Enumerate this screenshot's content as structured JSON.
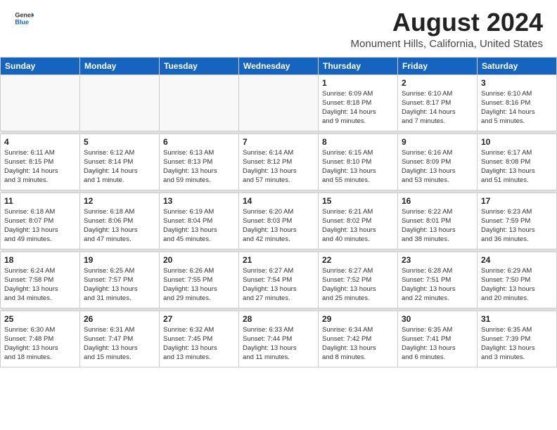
{
  "header": {
    "logo_general": "General",
    "logo_blue": "Blue",
    "month": "August 2024",
    "location": "Monument Hills, California, United States"
  },
  "weekdays": [
    "Sunday",
    "Monday",
    "Tuesday",
    "Wednesday",
    "Thursday",
    "Friday",
    "Saturday"
  ],
  "weeks": [
    [
      {
        "day": "",
        "info": ""
      },
      {
        "day": "",
        "info": ""
      },
      {
        "day": "",
        "info": ""
      },
      {
        "day": "",
        "info": ""
      },
      {
        "day": "1",
        "info": "Sunrise: 6:09 AM\nSunset: 8:18 PM\nDaylight: 14 hours\nand 9 minutes."
      },
      {
        "day": "2",
        "info": "Sunrise: 6:10 AM\nSunset: 8:17 PM\nDaylight: 14 hours\nand 7 minutes."
      },
      {
        "day": "3",
        "info": "Sunrise: 6:10 AM\nSunset: 8:16 PM\nDaylight: 14 hours\nand 5 minutes."
      }
    ],
    [
      {
        "day": "4",
        "info": "Sunrise: 6:11 AM\nSunset: 8:15 PM\nDaylight: 14 hours\nand 3 minutes."
      },
      {
        "day": "5",
        "info": "Sunrise: 6:12 AM\nSunset: 8:14 PM\nDaylight: 14 hours\nand 1 minute."
      },
      {
        "day": "6",
        "info": "Sunrise: 6:13 AM\nSunset: 8:13 PM\nDaylight: 13 hours\nand 59 minutes."
      },
      {
        "day": "7",
        "info": "Sunrise: 6:14 AM\nSunset: 8:12 PM\nDaylight: 13 hours\nand 57 minutes."
      },
      {
        "day": "8",
        "info": "Sunrise: 6:15 AM\nSunset: 8:10 PM\nDaylight: 13 hours\nand 55 minutes."
      },
      {
        "day": "9",
        "info": "Sunrise: 6:16 AM\nSunset: 8:09 PM\nDaylight: 13 hours\nand 53 minutes."
      },
      {
        "day": "10",
        "info": "Sunrise: 6:17 AM\nSunset: 8:08 PM\nDaylight: 13 hours\nand 51 minutes."
      }
    ],
    [
      {
        "day": "11",
        "info": "Sunrise: 6:18 AM\nSunset: 8:07 PM\nDaylight: 13 hours\nand 49 minutes."
      },
      {
        "day": "12",
        "info": "Sunrise: 6:18 AM\nSunset: 8:06 PM\nDaylight: 13 hours\nand 47 minutes."
      },
      {
        "day": "13",
        "info": "Sunrise: 6:19 AM\nSunset: 8:04 PM\nDaylight: 13 hours\nand 45 minutes."
      },
      {
        "day": "14",
        "info": "Sunrise: 6:20 AM\nSunset: 8:03 PM\nDaylight: 13 hours\nand 42 minutes."
      },
      {
        "day": "15",
        "info": "Sunrise: 6:21 AM\nSunset: 8:02 PM\nDaylight: 13 hours\nand 40 minutes."
      },
      {
        "day": "16",
        "info": "Sunrise: 6:22 AM\nSunset: 8:01 PM\nDaylight: 13 hours\nand 38 minutes."
      },
      {
        "day": "17",
        "info": "Sunrise: 6:23 AM\nSunset: 7:59 PM\nDaylight: 13 hours\nand 36 minutes."
      }
    ],
    [
      {
        "day": "18",
        "info": "Sunrise: 6:24 AM\nSunset: 7:58 PM\nDaylight: 13 hours\nand 34 minutes."
      },
      {
        "day": "19",
        "info": "Sunrise: 6:25 AM\nSunset: 7:57 PM\nDaylight: 13 hours\nand 31 minutes."
      },
      {
        "day": "20",
        "info": "Sunrise: 6:26 AM\nSunset: 7:55 PM\nDaylight: 13 hours\nand 29 minutes."
      },
      {
        "day": "21",
        "info": "Sunrise: 6:27 AM\nSunset: 7:54 PM\nDaylight: 13 hours\nand 27 minutes."
      },
      {
        "day": "22",
        "info": "Sunrise: 6:27 AM\nSunset: 7:52 PM\nDaylight: 13 hours\nand 25 minutes."
      },
      {
        "day": "23",
        "info": "Sunrise: 6:28 AM\nSunset: 7:51 PM\nDaylight: 13 hours\nand 22 minutes."
      },
      {
        "day": "24",
        "info": "Sunrise: 6:29 AM\nSunset: 7:50 PM\nDaylight: 13 hours\nand 20 minutes."
      }
    ],
    [
      {
        "day": "25",
        "info": "Sunrise: 6:30 AM\nSunset: 7:48 PM\nDaylight: 13 hours\nand 18 minutes."
      },
      {
        "day": "26",
        "info": "Sunrise: 6:31 AM\nSunset: 7:47 PM\nDaylight: 13 hours\nand 15 minutes."
      },
      {
        "day": "27",
        "info": "Sunrise: 6:32 AM\nSunset: 7:45 PM\nDaylight: 13 hours\nand 13 minutes."
      },
      {
        "day": "28",
        "info": "Sunrise: 6:33 AM\nSunset: 7:44 PM\nDaylight: 13 hours\nand 11 minutes."
      },
      {
        "day": "29",
        "info": "Sunrise: 6:34 AM\nSunset: 7:42 PM\nDaylight: 13 hours\nand 8 minutes."
      },
      {
        "day": "30",
        "info": "Sunrise: 6:35 AM\nSunset: 7:41 PM\nDaylight: 13 hours\nand 6 minutes."
      },
      {
        "day": "31",
        "info": "Sunrise: 6:35 AM\nSunset: 7:39 PM\nDaylight: 13 hours\nand 3 minutes."
      }
    ]
  ]
}
